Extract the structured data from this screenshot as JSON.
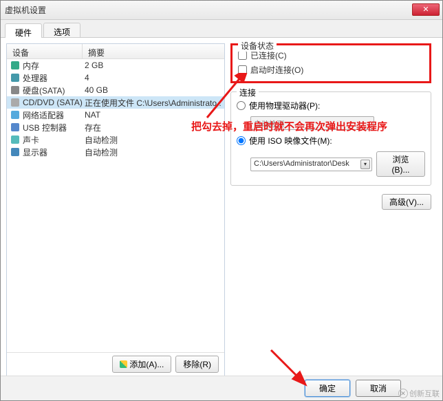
{
  "window": {
    "title": "虚拟机设置"
  },
  "tabs": {
    "hardware": "硬件",
    "options": "选项"
  },
  "list": {
    "header": {
      "device": "设备",
      "summary": "摘要"
    },
    "items": [
      {
        "name": "内存",
        "summary": "2 GB",
        "icon": "mem"
      },
      {
        "name": "处理器",
        "summary": "4",
        "icon": "cpu"
      },
      {
        "name": "硬盘(SATA)",
        "summary": "40 GB",
        "icon": "hdd"
      },
      {
        "name": "CD/DVD (SATA)",
        "summary": "正在使用文件 C:\\Users\\Administrato...",
        "icon": "cd",
        "selected": true
      },
      {
        "name": "网络适配器",
        "summary": "NAT",
        "icon": "net"
      },
      {
        "name": "USB 控制器",
        "summary": "存在",
        "icon": "usb"
      },
      {
        "name": "声卡",
        "summary": "自动检测",
        "icon": "snd"
      },
      {
        "name": "显示器",
        "summary": "自动检测",
        "icon": "disp"
      }
    ]
  },
  "buttons": {
    "add": "添加(A)...",
    "remove": "移除(R)",
    "browse": "浏览(B)...",
    "advanced": "高级(V)...",
    "ok": "确定",
    "cancel": "取消"
  },
  "device_status": {
    "title": "设备状态",
    "connected": "已连接(C)",
    "connect_at_power": "启动时连接(O)"
  },
  "connection": {
    "title": "连接",
    "use_physical": "使用物理驱动器(P):",
    "auto_detect": "自动检测",
    "use_iso": "使用 ISO 映像文件(M):",
    "path": "C:\\Users\\Administrator\\Desk"
  },
  "annotation": "把勾去掉，重启时就不会再次弹出安装程序",
  "watermark": "创新互联"
}
